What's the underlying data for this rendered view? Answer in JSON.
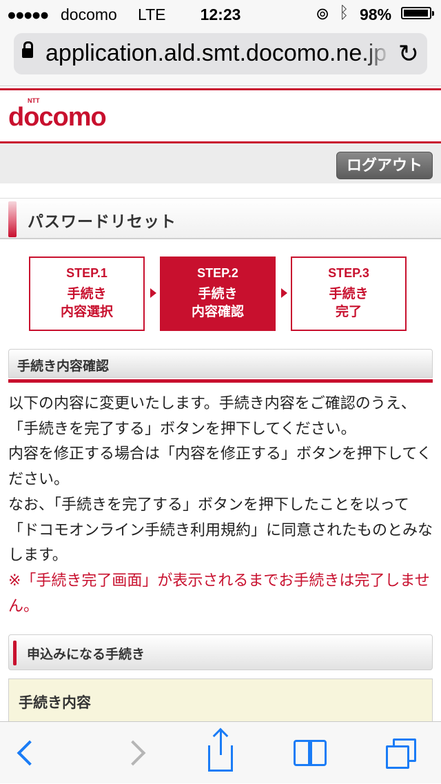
{
  "status_bar": {
    "signal": "●●●●●",
    "carrier": "docomo",
    "network": "LTE",
    "time": "12:23",
    "rotation_lock_icon": "rotation-lock-icon",
    "bluetooth_icon": "bluetooth-icon",
    "battery_pct": "98%",
    "battery_level": 0.98
  },
  "browser": {
    "url": "application.ald.smt.docomo.ne.jp",
    "reload_glyph": "↻"
  },
  "header": {
    "logo_text": "docomo",
    "logo_small": "NTT",
    "logout_label": "ログアウト"
  },
  "page": {
    "title": "パスワードリセット",
    "steps": [
      {
        "num": "STEP.1",
        "label": "手続き\n内容選択",
        "active": false
      },
      {
        "num": "STEP.2",
        "label": "手続き\n内容確認",
        "active": true
      },
      {
        "num": "STEP.3",
        "label": "手続き\n完了",
        "active": false
      }
    ],
    "section_title": "手続き内容確認",
    "paragraphs": [
      "以下の内容に変更いたします。手続き内容をご確認のうえ、「手続きを完了する」ボタンを押下してください。",
      "内容を修正する場合は「内容を修正する」ボタンを押下してください。",
      "なお、「手続きを完了する」ボタンを押下したことを以って「ドコモオンライン手続き利用規約」に同意されたものとみなします。"
    ],
    "notice": "※「手続き完了画面」が表示されるまでお手続きは完了しません。",
    "section2_title": "申込みになる手続き",
    "content_label": "手続き内容"
  },
  "colors": {
    "brand": "#c8102e",
    "ios_blue": "#1a7cf6"
  },
  "toolbar": {
    "icons": [
      "back-icon",
      "forward-icon",
      "share-icon",
      "bookmarks-icon",
      "tabs-icon"
    ]
  }
}
